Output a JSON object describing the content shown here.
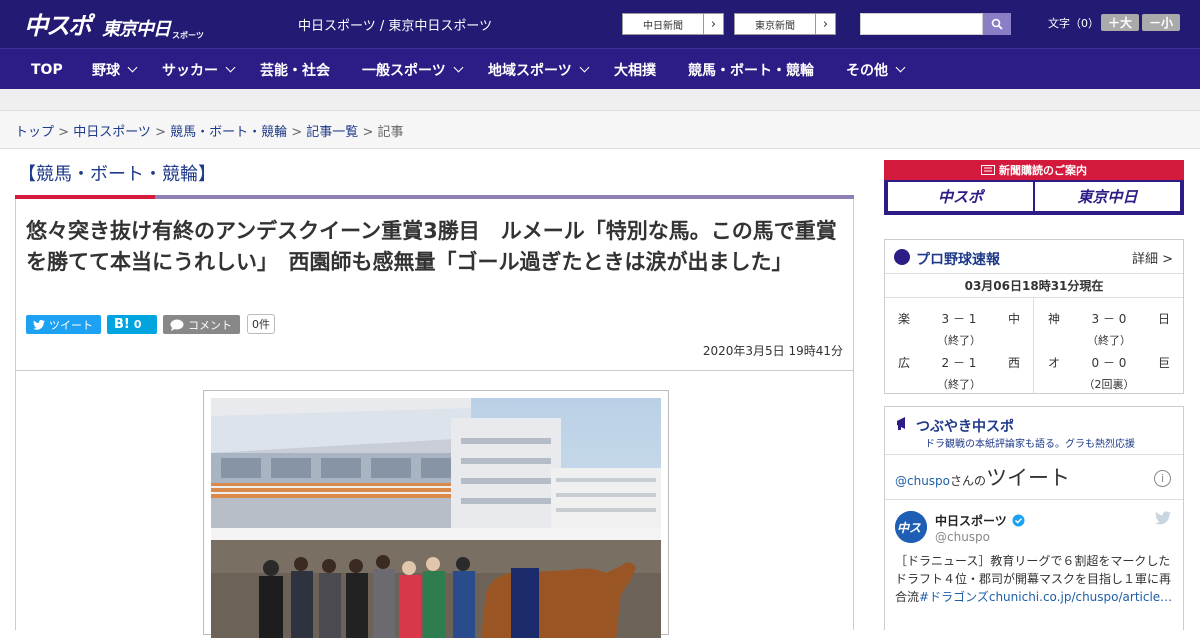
{
  "header": {
    "logo_main": "中スポ",
    "logo_sub": "東京中日",
    "logo_small": "スポーツ",
    "site_names": "中日スポーツ / 東京中日スポーツ",
    "ext_links": [
      {
        "label": "中日新聞"
      },
      {
        "label": "東京新聞"
      }
    ],
    "search": {
      "placeholder": ""
    },
    "font_size": {
      "label": "文字（0）",
      "larger": "＋大",
      "smaller": "－小"
    }
  },
  "nav": {
    "items": [
      {
        "label": "TOP"
      },
      {
        "label": "野球"
      },
      {
        "label": "サッカー"
      },
      {
        "label": "芸能・社会"
      },
      {
        "label": "一般スポーツ"
      },
      {
        "label": "地域スポーツ"
      },
      {
        "label": "大相撲"
      },
      {
        "label": "競馬・ボート・競輪"
      },
      {
        "label": "その他"
      }
    ]
  },
  "breadcrumb": {
    "items": [
      "トップ",
      "中日スポーツ",
      "競馬・ボート・競輪",
      "記事一覧"
    ],
    "current": "記事",
    "sep": " > "
  },
  "article": {
    "section": "【競馬・ボート・競輪】",
    "headline": "悠々突き抜け有終のアンデスクイーン重賞3勝目　ルメール「特別な馬。この馬で重賞を勝てて本当にうれしい」　西園師も感無量「ゴール過ぎたときは涙が出ました」",
    "share": {
      "tweet": "ツイート",
      "hatena": "B!",
      "hatena_count": "0",
      "comment": "コメント",
      "comment_count": "0件"
    },
    "date": "2020年3月5日 19時41分"
  },
  "sidebar": {
    "subscribe": {
      "title": "新聞購読のご案内",
      "btn1": "中スポ",
      "btn2": "東京中日"
    },
    "baseball": {
      "title": "プロ野球速報",
      "detail": "詳細 >",
      "time": "03月06日18時31分現在",
      "games": [
        {
          "team1": "楽",
          "score": "3 － 1",
          "team2": "中",
          "status": "（終了）"
        },
        {
          "team1": "神",
          "score": "3 － 0",
          "team2": "日",
          "status": "（終了）"
        },
        {
          "team1": "広",
          "score": "2 － 1",
          "team2": "西",
          "status": "（終了）"
        },
        {
          "team1": "オ",
          "score": "0 － 0",
          "team2": "巨",
          "status": "（2回裏）"
        }
      ]
    },
    "tweets": {
      "title": "つぶやき中スポ",
      "desc": "ドラ観戦の本紙評論家も語る。グラも熱烈応援",
      "handle": "@chuspo",
      "san_no": "さんの",
      "tweet_word": "ツイート",
      "name": "中日スポーツ",
      "screen_name": "@chuspo",
      "text": "［ドラニュース］教育リーグで６割超をマークしたドラフト４位・郡司が開幕マスクを目指し１軍に再合流",
      "hashtag": "#ドラゴンズ",
      "link": "chunichi.co.jp/chuspo/article…"
    }
  },
  "colors": {
    "brand": "#231a73",
    "nav": "#2b1d85",
    "accent_red": "#d41a3c",
    "link": "#1f3a8a"
  }
}
